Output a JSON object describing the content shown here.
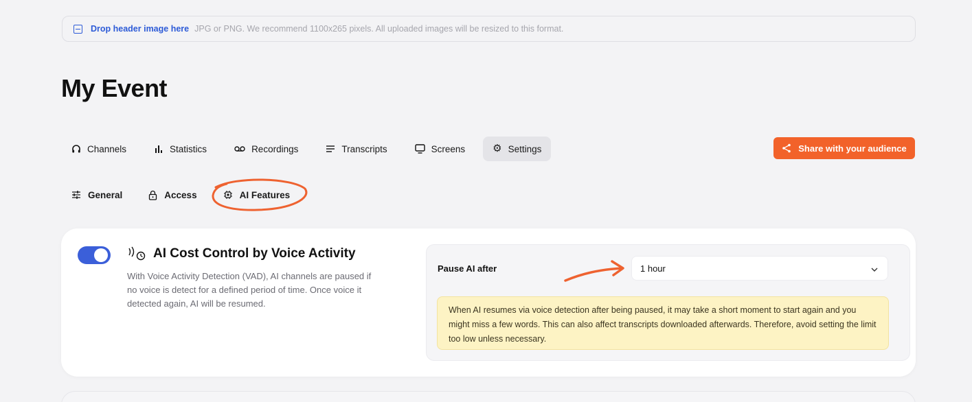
{
  "dropzone": {
    "label": "Drop header image here",
    "hint": "JPG or PNG. We recommend 1100x265 pixels. All uploaded images will be resized to this format."
  },
  "page": {
    "title": "My Event"
  },
  "tabs": [
    {
      "label": "Channels",
      "icon": "headphones-icon",
      "active": false
    },
    {
      "label": "Statistics",
      "icon": "bar-chart-icon",
      "active": false
    },
    {
      "label": "Recordings",
      "icon": "recording-icon",
      "active": false
    },
    {
      "label": "Transcripts",
      "icon": "lines-icon",
      "active": false
    },
    {
      "label": "Screens",
      "icon": "monitor-icon",
      "active": false
    },
    {
      "label": "Settings",
      "icon": "gear-icon",
      "active": true
    }
  ],
  "share": {
    "label": "Share with your audience",
    "icon": "share-icon",
    "color": "#f2622a"
  },
  "subtabs": [
    {
      "label": "General",
      "icon": "sliders-icon"
    },
    {
      "label": "Access",
      "icon": "lock-icon"
    },
    {
      "label": "AI Features",
      "icon": "chip-icon"
    }
  ],
  "feature": {
    "enabled": true,
    "title": "AI Cost Control by Voice Activity",
    "description": "With Voice Activity Detection (VAD), AI channels are paused if no voice is detect for a defined period of time. Once voice it detected again, AI will be resumed."
  },
  "pause": {
    "label": "Pause AI after",
    "selected": "1 hour",
    "notice": "When AI resumes via voice detection after being paused, it may take a short moment to start again and you might miss a few words. This can also affect transcripts downloaded afterwards. Therefore, avoid setting the limit too low unless necessary."
  },
  "colors": {
    "accent": "#3b5fd9",
    "brand": "#f2622a",
    "link": "#2d5bd7",
    "notice_bg": "#fdf3c4"
  }
}
